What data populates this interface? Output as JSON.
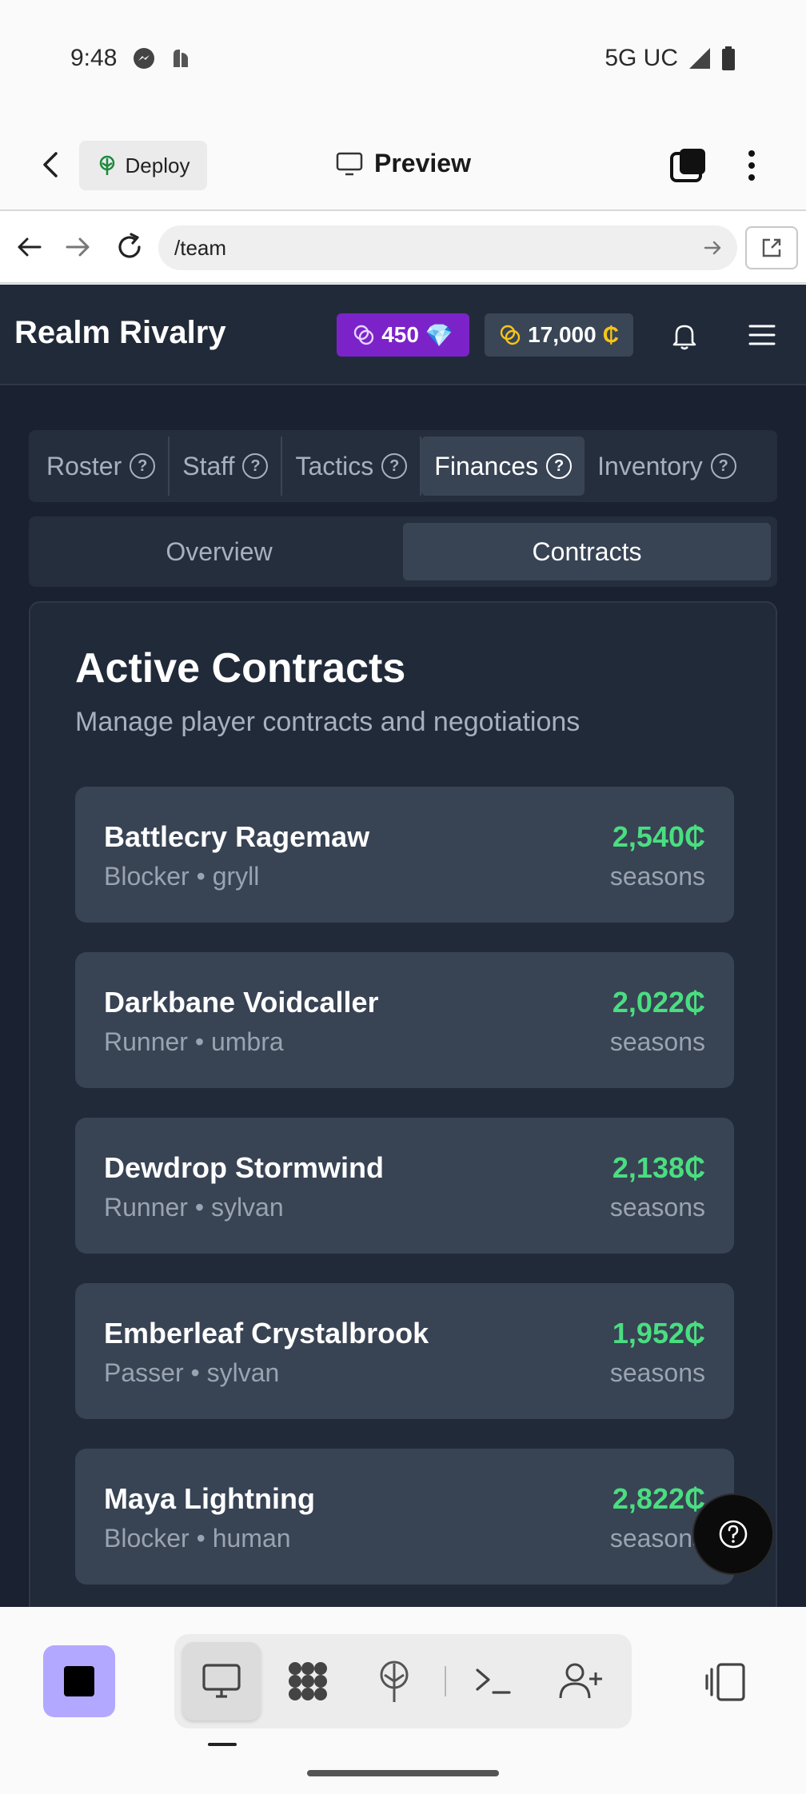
{
  "status_bar": {
    "time": "9:48",
    "network": "5G UC"
  },
  "app_toolbar": {
    "deploy_label": "Deploy",
    "preview_label": "Preview"
  },
  "url_bar": {
    "url": "/team"
  },
  "game": {
    "title": "Realm Rivalry",
    "gems": "450",
    "gem_icon": "💎",
    "coins": "17,000",
    "coin_symbol": "₵",
    "tabs": [
      {
        "label": "Roster",
        "active": false
      },
      {
        "label": "Staff",
        "active": false
      },
      {
        "label": "Tactics",
        "active": false
      },
      {
        "label": "Finances",
        "active": true
      },
      {
        "label": "Inventory",
        "active": false
      }
    ],
    "subtabs": [
      {
        "label": "Overview",
        "active": false
      },
      {
        "label": "Contracts",
        "active": true
      }
    ],
    "card": {
      "title": "Active Contracts",
      "subtitle": "Manage player contracts and negotiations",
      "contracts": [
        {
          "name": "Battlecry Ragemaw",
          "meta": "Blocker • gryll",
          "amount": "2,540₵",
          "period": "seasons"
        },
        {
          "name": "Darkbane Voidcaller",
          "meta": "Runner • umbra",
          "amount": "2,022₵",
          "period": "seasons"
        },
        {
          "name": "Dewdrop Stormwind",
          "meta": "Runner • sylvan",
          "amount": "2,138₵",
          "period": "seasons"
        },
        {
          "name": "Emberleaf Crystalbrook",
          "meta": "Passer • sylvan",
          "amount": "1,952₵",
          "period": "seasons"
        },
        {
          "name": "Maya Lightning",
          "meta": "Blocker • human",
          "amount": "2,822₵",
          "period": "seasons"
        }
      ]
    }
  },
  "colors": {
    "game_bg": "#1a2231",
    "card_bg": "#212a39",
    "row_bg": "#384354",
    "gem_pill": "#7b23c9",
    "amount_green": "#4ade80",
    "stop_button": "#b3a8ff"
  },
  "icons": {
    "status_left": [
      "messenger-icon",
      "notification-icon"
    ],
    "status_right": [
      "signal-icon",
      "battery-icon"
    ],
    "bottom_tools": [
      "desktop-icon",
      "grid-icon",
      "deploy-icon",
      "terminal-icon",
      "add-user-icon"
    ]
  }
}
